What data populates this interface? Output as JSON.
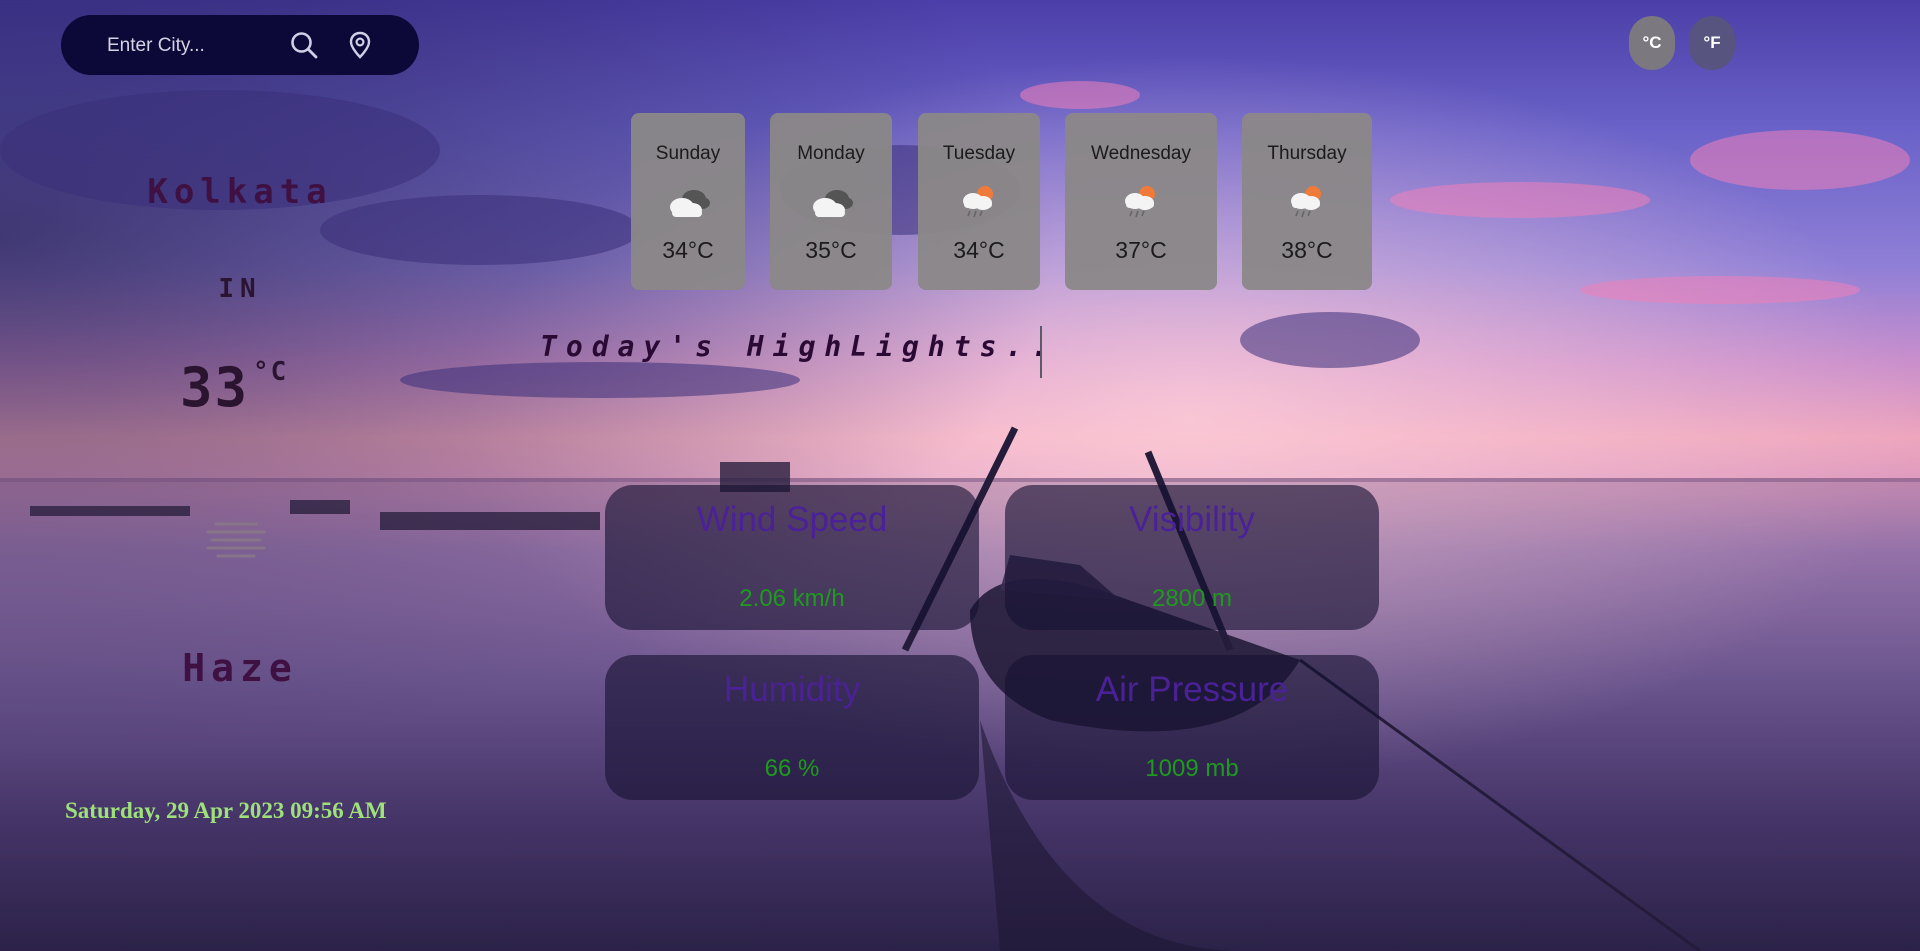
{
  "search": {
    "placeholder": "Enter City..."
  },
  "units": {
    "celsius_label": "°C",
    "fahrenheit_label": "°F"
  },
  "current": {
    "city": "Kolkata",
    "country": "IN",
    "temperature": "33",
    "temperature_unit": "°C",
    "condition": "Haze",
    "condition_icon": "haze-icon",
    "datetime": "Saturday, 29 Apr 2023 09:56 AM"
  },
  "forecast": [
    {
      "day": "Sunday",
      "icon": "cloudy-icon",
      "temp": "34°C"
    },
    {
      "day": "Monday",
      "icon": "cloudy-icon",
      "temp": "35°C"
    },
    {
      "day": "Tuesday",
      "icon": "sun-rain-cloud-icon",
      "temp": "34°C"
    },
    {
      "day": "Wednesday",
      "icon": "sun-rain-cloud-icon",
      "temp": "37°C"
    },
    {
      "day": "Thursday",
      "icon": "sun-rain-cloud-icon",
      "temp": "38°C"
    }
  ],
  "highlights_title": "Today's HighLights..",
  "highlights": {
    "wind_speed": {
      "label": "Wind Speed",
      "value": "2.06 km/h"
    },
    "visibility": {
      "label": "Visibility",
      "value": "2800 m"
    },
    "humidity": {
      "label": "Humidity",
      "value": "66 %"
    },
    "air_pressure": {
      "label": "Air Pressure",
      "value": "1009 mb"
    }
  },
  "colors": {
    "search_bg": "#0c0838",
    "city_text": "#3f1142",
    "datetime_text": "#9ee17a",
    "card_title": "#4a2196",
    "card_value": "#1f9a1f",
    "celsius_btn": "#7b7880",
    "fahrenheit_btn": "#57557f"
  }
}
